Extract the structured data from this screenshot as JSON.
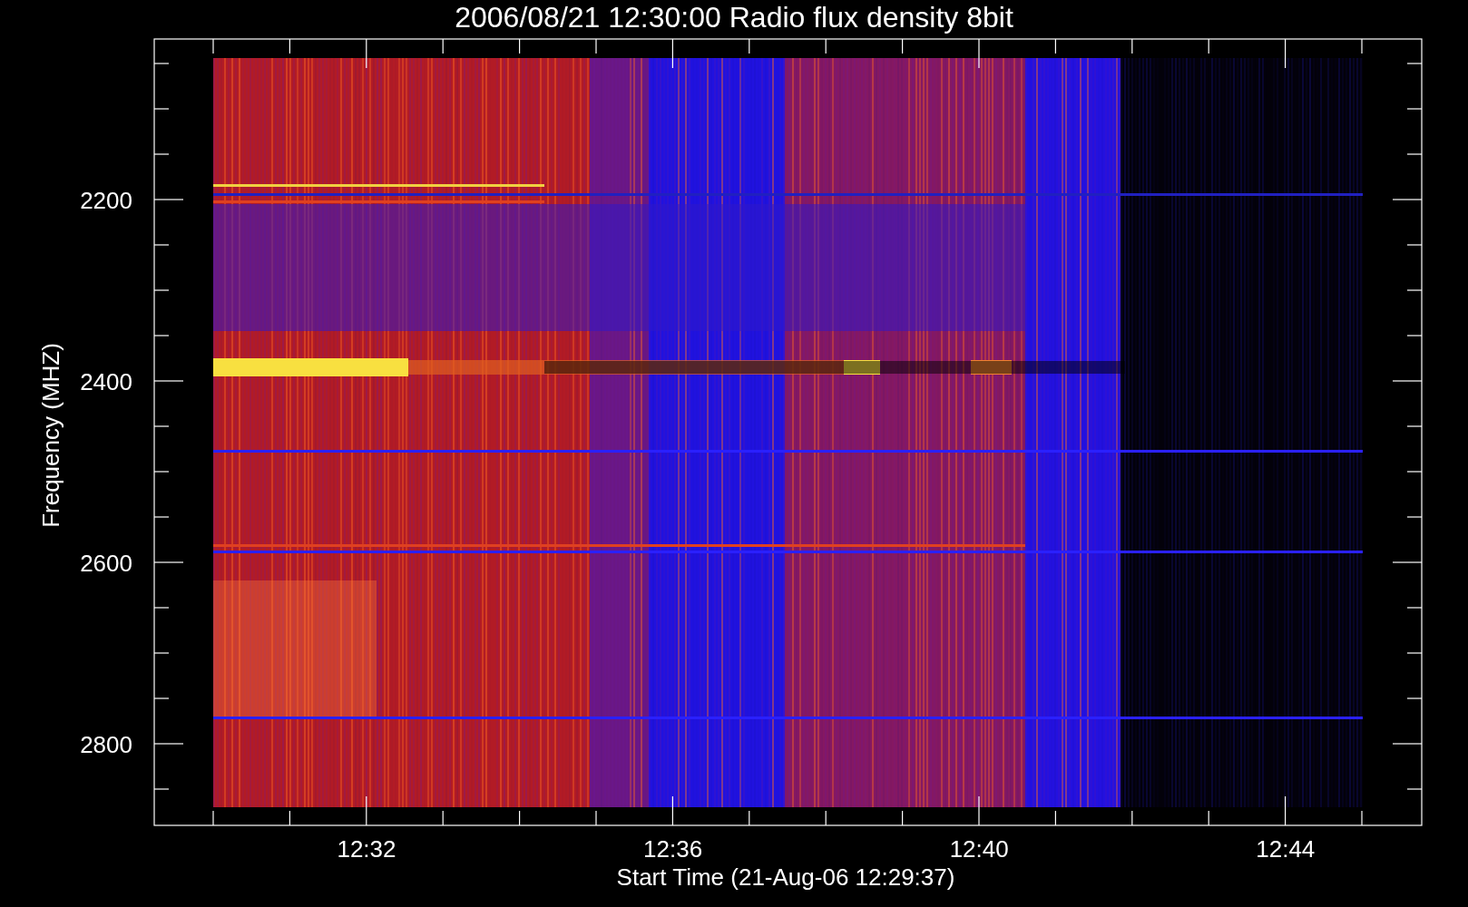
{
  "title": "2006/08/21 12:30:00 Radio flux density 8bit",
  "y_axis": {
    "label": "Frequency (MHZ)",
    "ticks": [
      "2200",
      "2400",
      "2600",
      "2800"
    ]
  },
  "x_axis": {
    "label": "Start Time (21-Aug-06 12:29:37)",
    "ticks": [
      "12:32",
      "12:36",
      "12:40",
      "12:44"
    ]
  }
}
